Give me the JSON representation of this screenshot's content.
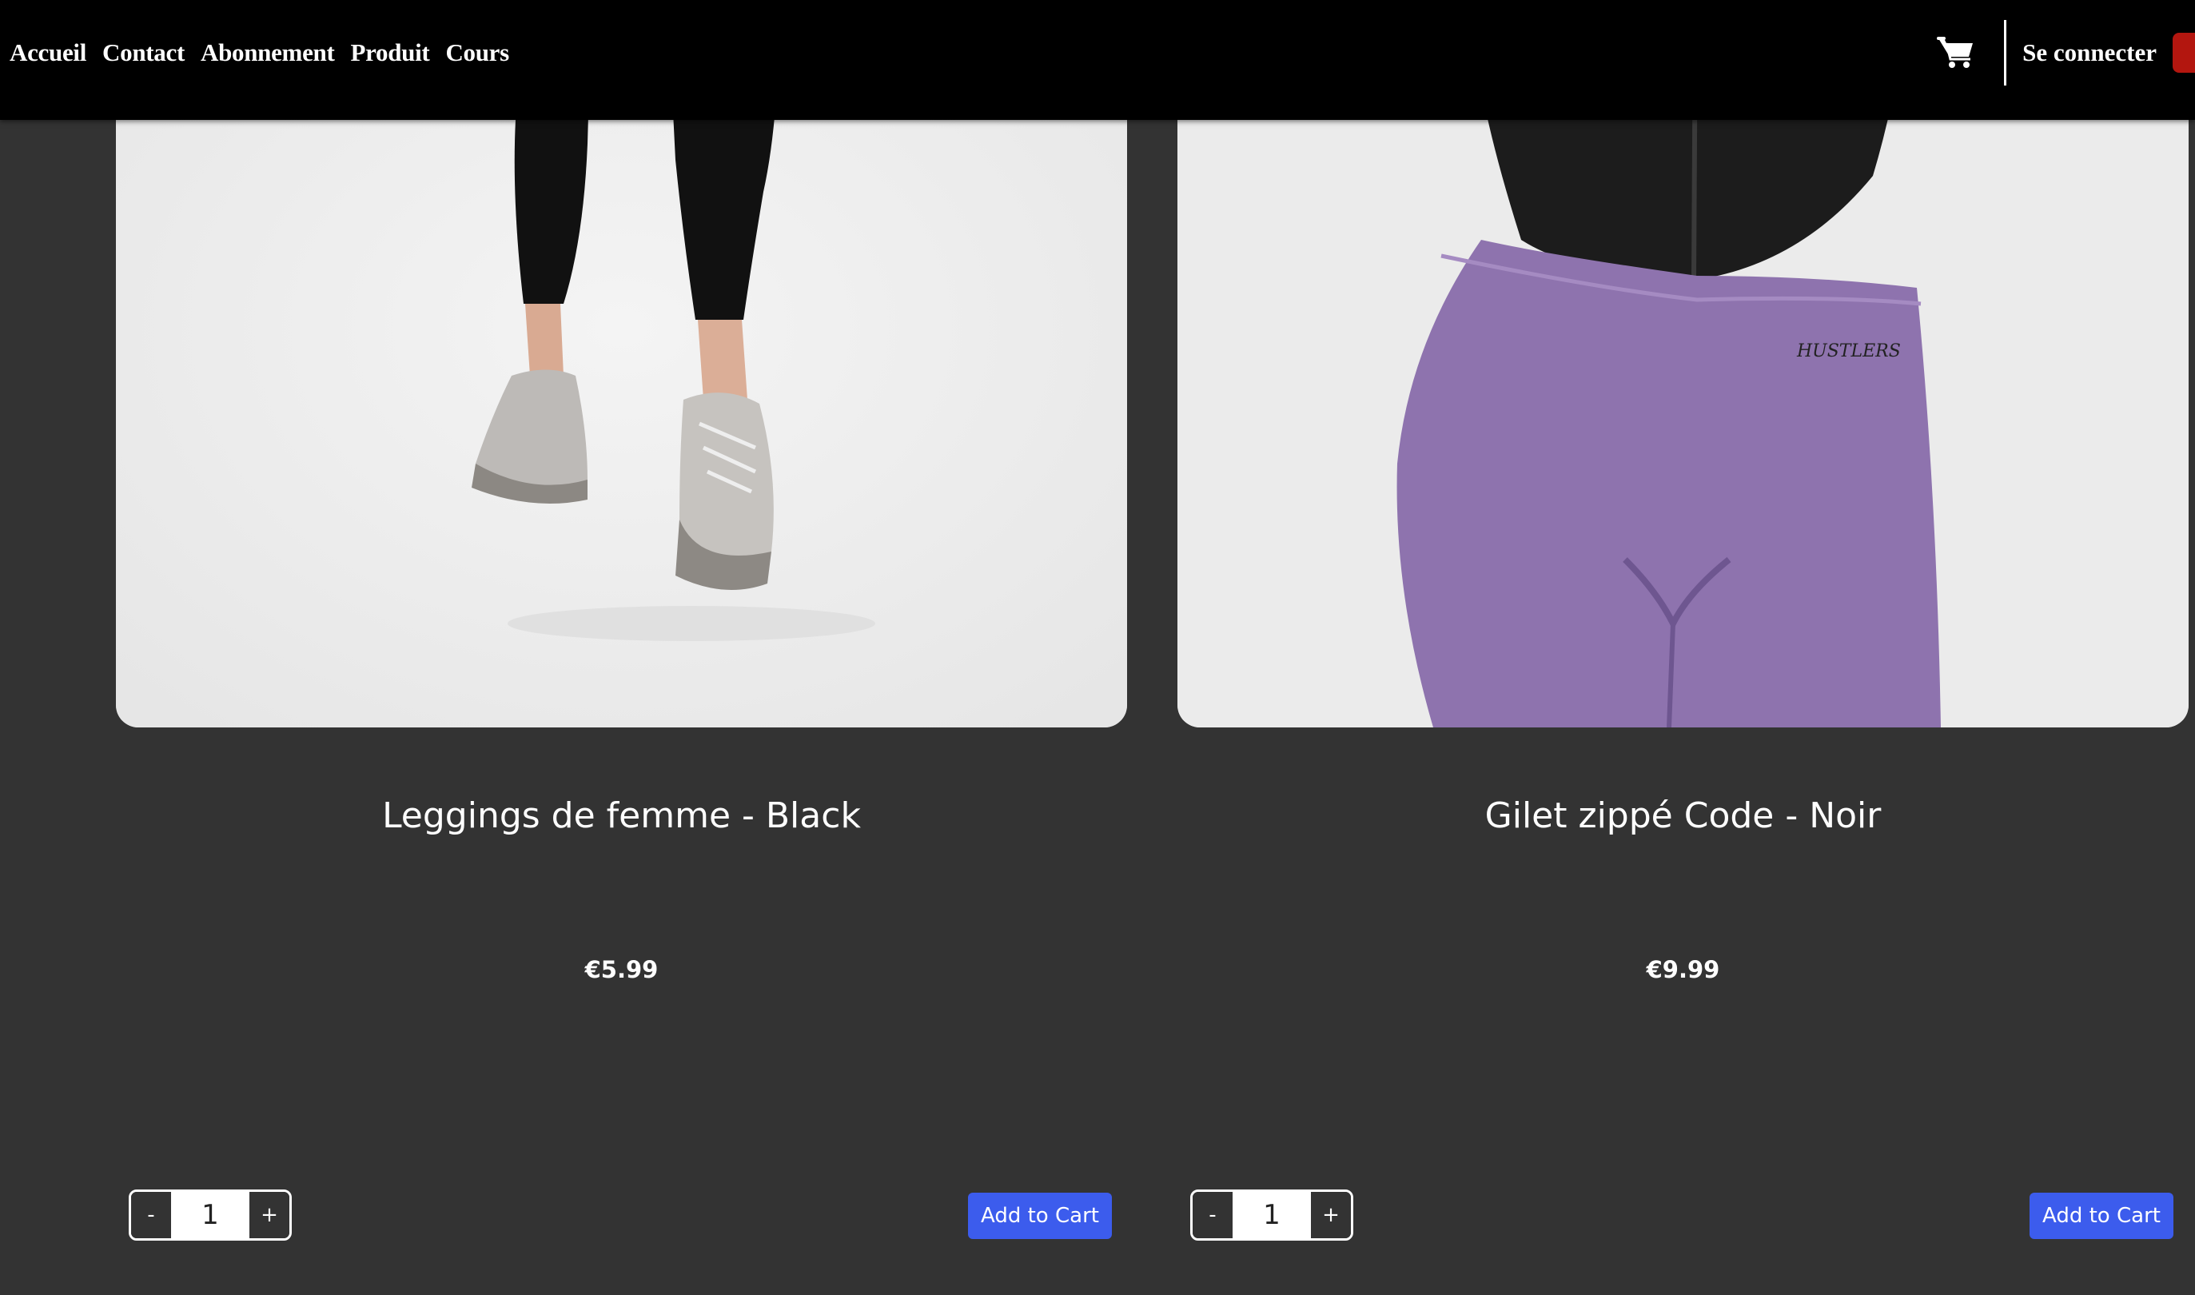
{
  "nav": {
    "links": [
      "Accueil",
      "Contact",
      "Abonnement",
      "Produit",
      "Cours"
    ],
    "login_label": "Se connecter",
    "cart_icon": "shopping-cart-icon"
  },
  "products": [
    {
      "title": "Leggings de femme - Black",
      "price": "€5.99",
      "quantity": "1",
      "minus_label": "-",
      "plus_label": "+",
      "add_label": "Add to Cart"
    },
    {
      "title": "Gilet zippé Code - Noir",
      "price": "€9.99",
      "quantity": "1",
      "minus_label": "-",
      "plus_label": "+",
      "add_label": "Add to Cart",
      "image_brand_text": "HUSTLERS"
    }
  ],
  "colors": {
    "background": "#333333",
    "navbar": "#000000",
    "accent_button": "#3c5ced",
    "red_button": "#b3160f"
  }
}
